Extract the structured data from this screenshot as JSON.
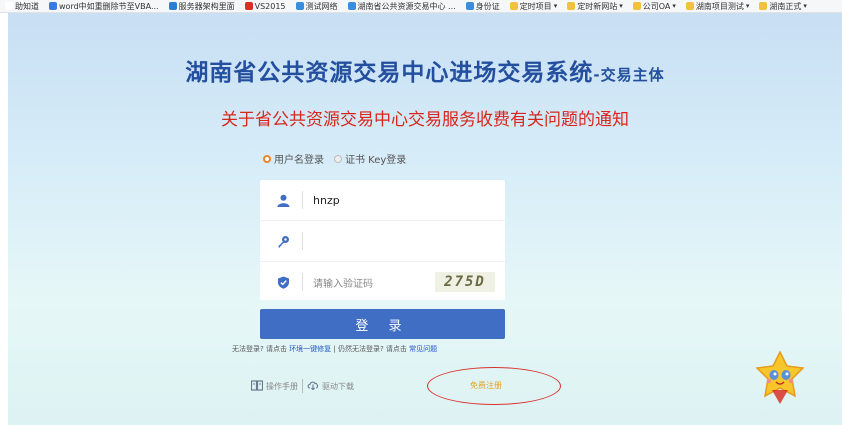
{
  "bookmarks": [
    {
      "label": "助知道",
      "color": "#ffffff"
    },
    {
      "label": "word中如重删除节至VBA...",
      "color": "#3a7be0"
    },
    {
      "label": "服务器架构里面",
      "color": "#2a7fd4"
    },
    {
      "label": "VS2015",
      "color": "#d93025"
    },
    {
      "label": "测试网络",
      "color": "#3a8dde"
    },
    {
      "label": "湖南省公共资源交易中心 ...",
      "color": "#3a8dde"
    },
    {
      "label": "身份证",
      "color": "#3a8dde"
    },
    {
      "label": "定时项目",
      "color": "#f2c23c",
      "caret": "▾"
    },
    {
      "label": "定时新网站",
      "color": "#f2c23c",
      "caret": "▾"
    },
    {
      "label": "公司OA",
      "color": "#f2c23c",
      "caret": "▾"
    },
    {
      "label": "湖南项目测试",
      "color": "#f2c23c",
      "caret": "▾"
    },
    {
      "label": "湖南正式",
      "color": "#f2c23c",
      "caret": "▾"
    }
  ],
  "header": {
    "title": "湖南省公共资源交易中心进场交易系统",
    "subtitle": "-交易主体",
    "notice": "关于省公共资源交易中心交易服务收费有关问题的通知"
  },
  "login": {
    "tab_user": "用户名登录",
    "tab_cert": "证书 Key登录",
    "username_value": "hnzp",
    "password_value": "",
    "captcha_placeholder": "请输入验证码",
    "captcha_code": "275D",
    "submit_label": "登 录"
  },
  "help": {
    "prefix": "无法登录? 请点击",
    "repair_link": "环境一键修复",
    "middle": " | 仍然无法登录? 请点击",
    "faq_link": "常见问题"
  },
  "tools": {
    "manual": "操作手册",
    "driver": "驱动下载",
    "register": "免费注册"
  },
  "colors": {
    "title": "#234f9e",
    "notice": "#d9261c",
    "button": "#3f6ec4",
    "register": "#e8a023",
    "annotation": "#d8322c"
  }
}
